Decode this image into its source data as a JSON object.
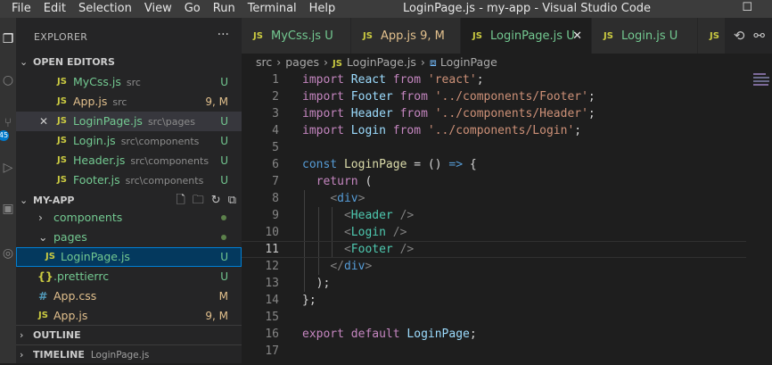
{
  "menu": [
    "File",
    "Edit",
    "Selection",
    "View",
    "Go",
    "Run",
    "Terminal",
    "Help"
  ],
  "window_title": "LoginPage.js - my-app - Visual Studio Code",
  "sidebar": {
    "title": "EXPLORER",
    "more": "···",
    "open_editors": {
      "label": "OPEN EDITORS",
      "items": [
        {
          "name": "MyCss.js",
          "desc": "src",
          "status": "U"
        },
        {
          "name": "App.js",
          "desc": "src",
          "status": "9, M"
        },
        {
          "name": "LoginPage.js",
          "desc": "src\\pages",
          "status": "U"
        },
        {
          "name": "Login.js",
          "desc": "src\\components",
          "status": "U"
        },
        {
          "name": "Header.js",
          "desc": "src\\components",
          "status": "U"
        },
        {
          "name": "Footer.js",
          "desc": "src\\components",
          "status": "U"
        }
      ]
    },
    "project": {
      "label": "MY-APP",
      "items": [
        {
          "name": "components"
        },
        {
          "name": "pages"
        },
        {
          "name": "LoginPage.js",
          "status": "U"
        },
        {
          "name": ".prettierrc",
          "status": "U"
        },
        {
          "name": "App.css",
          "status": "M"
        },
        {
          "name": "App.js",
          "status": "9, M"
        }
      ]
    },
    "outline": "OUTLINE",
    "timeline": {
      "label": "TIMELINE",
      "sub": "LoginPage.js"
    }
  },
  "tabs": [
    {
      "name": "MyCss.js",
      "status": "U"
    },
    {
      "name": "App.js",
      "status": "9, M"
    },
    {
      "name": "LoginPage.js",
      "status": "U"
    },
    {
      "name": "Login.js",
      "status": "U"
    },
    {
      "name": "JS"
    }
  ],
  "breadcrumb": {
    "src": "src",
    "pages": "pages",
    "file": "LoginPage.js",
    "symbol": "LoginPage"
  },
  "line_numbers": [
    "1",
    "2",
    "3",
    "4",
    "5",
    "6",
    "7",
    "8",
    "9",
    "10",
    "11",
    "12",
    "13",
    "14",
    "15",
    "16",
    "17"
  ],
  "icons": {
    "js": "JS",
    "css": "#",
    "json": "{}"
  },
  "colors": {
    "accent": "#007acc",
    "untracked": "#73c991",
    "modified": "#e2c08d"
  }
}
